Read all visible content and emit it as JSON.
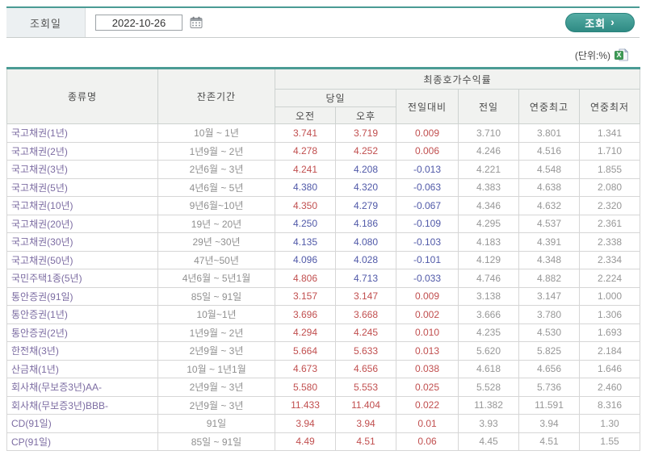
{
  "colors": {
    "accent_teal": "#4A9B94",
    "up_red": "#C14F4F",
    "down_blue": "#5059A8",
    "type_purple": "#7C6CA2",
    "header_bg": "#F1F2F0",
    "label_cell_bg": "#ECF0F2"
  },
  "toolbar": {
    "date_label": "조회일",
    "date_value": "2022-10-26",
    "calendar_icon": "calendar-icon",
    "search_label": "조회",
    "search_arrow": "›"
  },
  "unit_note": "(단위:%)",
  "icons": {
    "excel": "excel-icon",
    "excel_letter": "X"
  },
  "table": {
    "header": {
      "col_type": "종류명",
      "col_period": "잔존기간",
      "group_yield": "최종호가수익률",
      "group_today": "당일",
      "col_am": "오전",
      "col_pm": "오후",
      "col_change": "전일대비",
      "col_prev": "전일",
      "col_year_high": "연중최고",
      "col_year_low": "연중최저"
    },
    "rows": [
      {
        "name": "국고채권(1년)",
        "period": "10월 ~ 1년",
        "am": "3.741",
        "am_dir": "up",
        "pm": "3.719",
        "pm_dir": "up",
        "chg": "0.009",
        "chg_dir": "up",
        "prev": "3.710",
        "high": "3.801",
        "low": "1.341"
      },
      {
        "name": "국고채권(2년)",
        "period": "1년9월 ~ 2년",
        "am": "4.278",
        "am_dir": "up",
        "pm": "4.252",
        "pm_dir": "up",
        "chg": "0.006",
        "chg_dir": "up",
        "prev": "4.246",
        "high": "4.516",
        "low": "1.710"
      },
      {
        "name": "국고채권(3년)",
        "period": "2년6월 ~ 3년",
        "am": "4.241",
        "am_dir": "up",
        "pm": "4.208",
        "pm_dir": "down",
        "chg": "-0.013",
        "chg_dir": "down",
        "prev": "4.221",
        "high": "4.548",
        "low": "1.855"
      },
      {
        "name": "국고채권(5년)",
        "period": "4년6월 ~ 5년",
        "am": "4.380",
        "am_dir": "down",
        "pm": "4.320",
        "pm_dir": "down",
        "chg": "-0.063",
        "chg_dir": "down",
        "prev": "4.383",
        "high": "4.638",
        "low": "2.080"
      },
      {
        "name": "국고채권(10년)",
        "period": "9년6월~10년",
        "am": "4.350",
        "am_dir": "up",
        "pm": "4.279",
        "pm_dir": "down",
        "chg": "-0.067",
        "chg_dir": "down",
        "prev": "4.346",
        "high": "4.632",
        "low": "2.320"
      },
      {
        "name": "국고채권(20년)",
        "period": "19년 ~ 20년",
        "am": "4.250",
        "am_dir": "down",
        "pm": "4.186",
        "pm_dir": "down",
        "chg": "-0.109",
        "chg_dir": "down",
        "prev": "4.295",
        "high": "4.537",
        "low": "2.361"
      },
      {
        "name": "국고채권(30년)",
        "period": "29년 ~30년",
        "am": "4.135",
        "am_dir": "down",
        "pm": "4.080",
        "pm_dir": "down",
        "chg": "-0.103",
        "chg_dir": "down",
        "prev": "4.183",
        "high": "4.391",
        "low": "2.338"
      },
      {
        "name": "국고채권(50년)",
        "period": "47년~50년",
        "am": "4.096",
        "am_dir": "down",
        "pm": "4.028",
        "pm_dir": "down",
        "chg": "-0.101",
        "chg_dir": "down",
        "prev": "4.129",
        "high": "4.348",
        "low": "2.334"
      },
      {
        "name": "국민주택1종(5년)",
        "period": "4년6월 ~ 5년1월",
        "am": "4.806",
        "am_dir": "up",
        "pm": "4.713",
        "pm_dir": "down",
        "chg": "-0.033",
        "chg_dir": "down",
        "prev": "4.746",
        "high": "4.882",
        "low": "2.224"
      },
      {
        "name": "통안증권(91일)",
        "period": "85일 ~ 91일",
        "am": "3.157",
        "am_dir": "up",
        "pm": "3.147",
        "pm_dir": "up",
        "chg": "0.009",
        "chg_dir": "up",
        "prev": "3.138",
        "high": "3.147",
        "low": "1.000"
      },
      {
        "name": "통안증권(1년)",
        "period": "10월~1년",
        "am": "3.696",
        "am_dir": "up",
        "pm": "3.668",
        "pm_dir": "up",
        "chg": "0.002",
        "chg_dir": "up",
        "prev": "3.666",
        "high": "3.780",
        "low": "1.306"
      },
      {
        "name": "통안증권(2년)",
        "period": "1년9월 ~ 2년",
        "am": "4.294",
        "am_dir": "up",
        "pm": "4.245",
        "pm_dir": "up",
        "chg": "0.010",
        "chg_dir": "up",
        "prev": "4.235",
        "high": "4.530",
        "low": "1.693"
      },
      {
        "name": "한전채(3년)",
        "period": "2년9월 ~ 3년",
        "am": "5.664",
        "am_dir": "up",
        "pm": "5.633",
        "pm_dir": "up",
        "chg": "0.013",
        "chg_dir": "up",
        "prev": "5.620",
        "high": "5.825",
        "low": "2.184"
      },
      {
        "name": "산금채(1년)",
        "period": "10월 ~ 1년1월",
        "am": "4.673",
        "am_dir": "up",
        "pm": "4.656",
        "pm_dir": "up",
        "chg": "0.038",
        "chg_dir": "up",
        "prev": "4.618",
        "high": "4.656",
        "low": "1.646"
      },
      {
        "name": "회사채(무보증3년)AA-",
        "period": "2년9월 ~ 3년",
        "am": "5.580",
        "am_dir": "up",
        "pm": "5.553",
        "pm_dir": "up",
        "chg": "0.025",
        "chg_dir": "up",
        "prev": "5.528",
        "high": "5.736",
        "low": "2.460"
      },
      {
        "name": "회사채(무보증3년)BBB-",
        "period": "2년9월 ~ 3년",
        "am": "11.433",
        "am_dir": "up",
        "pm": "11.404",
        "pm_dir": "up",
        "chg": "0.022",
        "chg_dir": "up",
        "prev": "11.382",
        "high": "11.591",
        "low": "8.316"
      },
      {
        "name": "CD(91일)",
        "period": "91일",
        "am": "3.94",
        "am_dir": "up",
        "pm": "3.94",
        "pm_dir": "up",
        "chg": "0.01",
        "chg_dir": "up",
        "prev": "3.93",
        "high": "3.94",
        "low": "1.30"
      },
      {
        "name": "CP(91일)",
        "period": "85일 ~ 91일",
        "am": "4.49",
        "am_dir": "up",
        "pm": "4.51",
        "pm_dir": "up",
        "chg": "0.06",
        "chg_dir": "up",
        "prev": "4.45",
        "high": "4.51",
        "low": "1.55"
      }
    ]
  }
}
